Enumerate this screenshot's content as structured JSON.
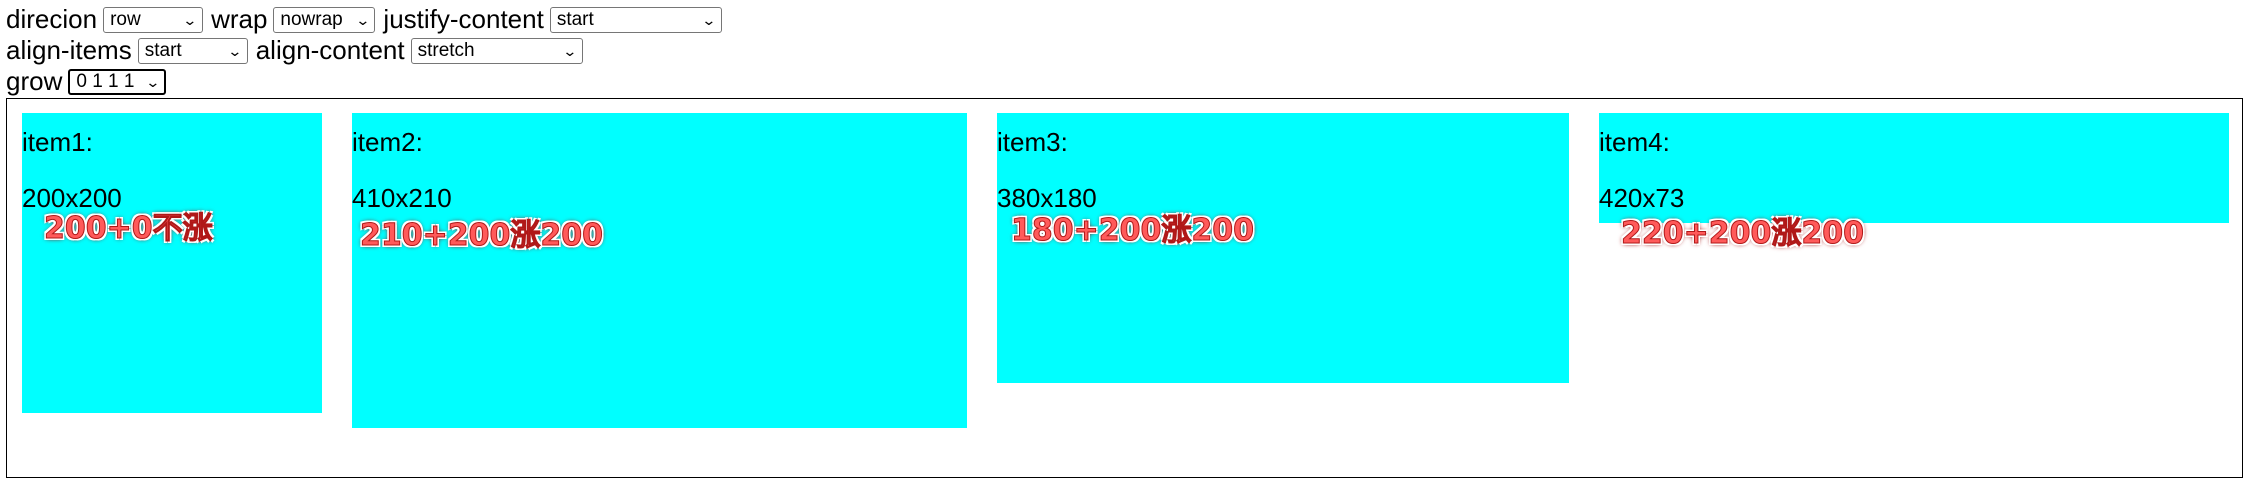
{
  "controls": {
    "direction": {
      "label": "direcion",
      "value": "row"
    },
    "wrap": {
      "label": "wrap",
      "value": "nowrap"
    },
    "justify_content": {
      "label": "justify-content",
      "value": "start"
    },
    "align_items": {
      "label": "align-items",
      "value": "start"
    },
    "align_content": {
      "label": "align-content",
      "value": "stretch"
    },
    "grow": {
      "label": "grow",
      "value": "0 1 1 1"
    }
  },
  "items": [
    {
      "name": "item1:",
      "size": "200x200",
      "note": "200+0不涨"
    },
    {
      "name": "item2:",
      "size": "410x210",
      "note": "210+200涨200"
    },
    {
      "name": "item3:",
      "size": "380x180",
      "note": "180+200涨200"
    },
    {
      "name": "item4:",
      "size": "420x73",
      "note": "220+200涨200"
    }
  ],
  "colors": {
    "item_background": "#00ffff",
    "annotation": "#ff5a5a"
  }
}
